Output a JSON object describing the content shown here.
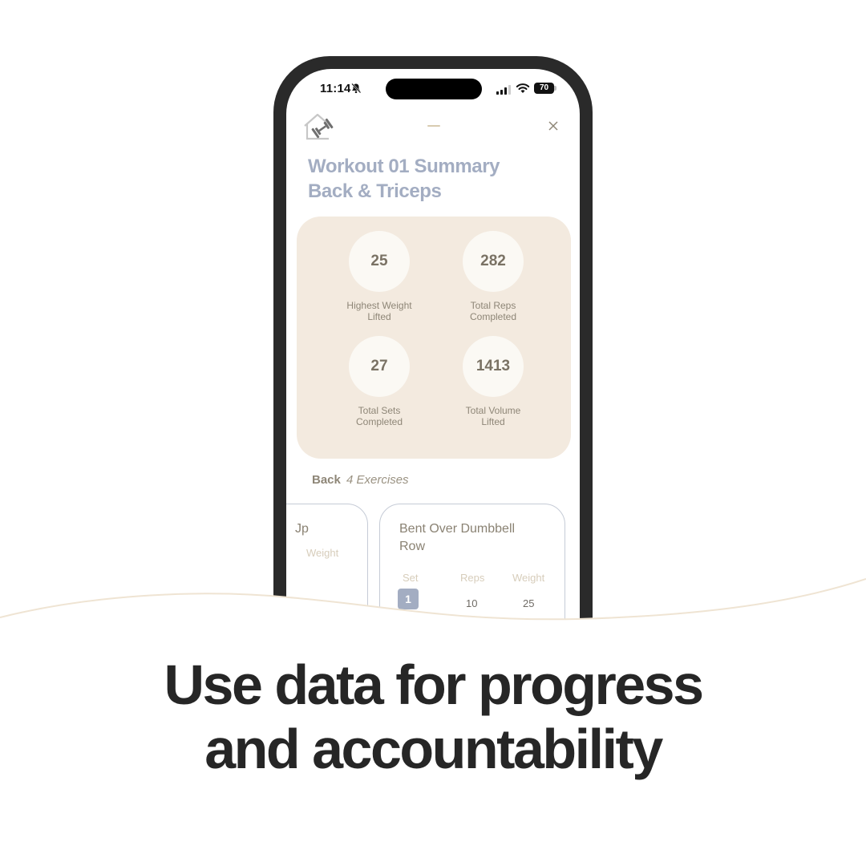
{
  "status_bar": {
    "time": "11:14",
    "silent_icon": "bell-slash-icon",
    "battery": "70"
  },
  "app_header": {
    "logo_icon": "home-dumbbell-icon",
    "close_icon": "close-icon"
  },
  "summary": {
    "title_line1": "Workout 01 Summary",
    "title_line2": "Back & Triceps"
  },
  "stats": [
    {
      "value": "25",
      "label_line1": "Highest Weight",
      "label_line2": "Lifted"
    },
    {
      "value": "282",
      "label_line1": "Total Reps",
      "label_line2": "Completed"
    },
    {
      "value": "27",
      "label_line1": "Total Sets",
      "label_line2": "Completed"
    },
    {
      "value": "1413",
      "label_line1": "Total Volume",
      "label_line2": "Lifted"
    }
  ],
  "section": {
    "name": "Back",
    "count": "4 Exercises"
  },
  "exercises": {
    "previous": {
      "title_fragment": "Jp",
      "col_weight": "Weight"
    },
    "current": {
      "title": "Bent Over Dumbbell Row",
      "columns": [
        "Set",
        "Reps",
        "Weight"
      ],
      "rows": [
        {
          "set": "1",
          "reps": "10",
          "weight": "25"
        }
      ]
    }
  },
  "tagline": {
    "line1": "Use data for progress",
    "line2": "and accountability"
  },
  "colors": {
    "title_blue": "#a3adc2",
    "card_beige": "#f3eadf",
    "stat_text": "#7a7264",
    "phone_frame": "#2a2a2a",
    "tagline": "#262626"
  }
}
